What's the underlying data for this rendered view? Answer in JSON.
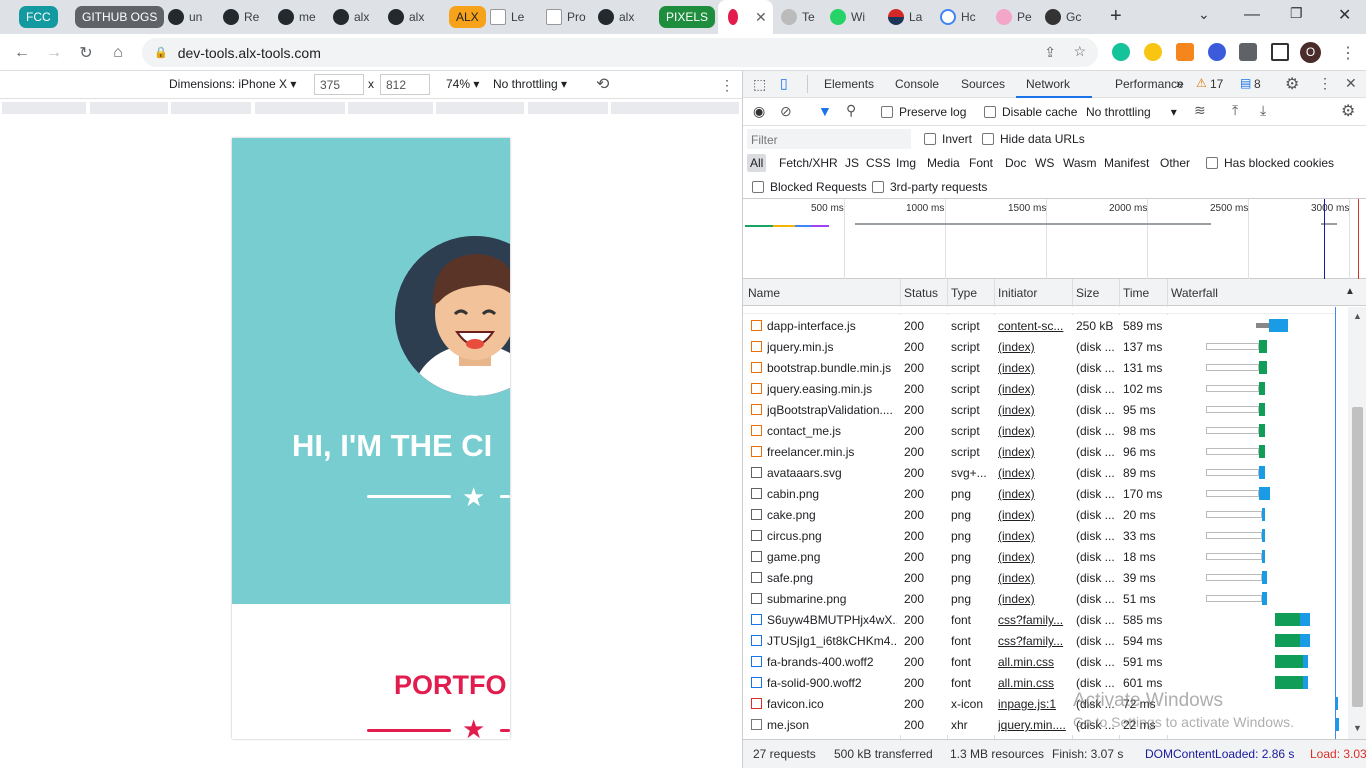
{
  "browser": {
    "tab_groups": [
      {
        "label": "FCC",
        "color": "#129aa0"
      },
      {
        "label": "GITHUB OGS",
        "color": "#5f6368"
      },
      {
        "label": "ALX",
        "color": "#f6a21b"
      },
      {
        "label": "PIXELS",
        "color": "#1e8e3e"
      }
    ],
    "tabs": [
      "un",
      "Re",
      "me",
      "alx",
      "alx",
      "Le",
      "Pro",
      "alx",
      "Te",
      "Wi",
      "La",
      "Hc",
      "Pe",
      "Gc"
    ],
    "url": "dev-tools.alx-tools.com",
    "profile_initial": "O"
  },
  "device_toolbar": {
    "dimensions_label": "Dimensions: iPhone X",
    "width": "375",
    "times": "x",
    "height": "812",
    "zoom": "74%",
    "throttle": "No throttling"
  },
  "page": {
    "hero_title": "HI, I'M THE CI",
    "section_title": "PORTFO",
    "masthead_color": "#78cdd1",
    "accent_color": "#e21d4e"
  },
  "devtools": {
    "tabs": [
      "Elements",
      "Console",
      "Sources",
      "Network",
      "Performance"
    ],
    "active_tab": "Network",
    "warnings": "17",
    "messages": "8",
    "preserve_log": "Preserve log",
    "disable_cache": "Disable cache",
    "throttling": "No throttling",
    "filter_placeholder": "Filter",
    "invert": "Invert",
    "hide_data_urls": "Hide data URLs",
    "type_filters": [
      "All",
      "Fetch/XHR",
      "JS",
      "CSS",
      "Img",
      "Media",
      "Font",
      "Doc",
      "WS",
      "Wasm",
      "Manifest",
      "Other"
    ],
    "has_blocked_cookies": "Has blocked cookies",
    "blocked_requests": "Blocked Requests",
    "third_party": "3rd-party requests",
    "overview_ticks": [
      "500 ms",
      "1000 ms",
      "1500 ms",
      "2000 ms",
      "2500 ms",
      "3000 ms"
    ],
    "columns": [
      "Name",
      "Status",
      "Type",
      "Initiator",
      "Size",
      "Time",
      "Waterfall"
    ],
    "rows": [
      {
        "name": "dapp-interface.js",
        "status": "200",
        "type": "script",
        "initiator": "content-sc...",
        "size": "250 kB",
        "time": "589 ms",
        "wstart": 0.5,
        "wwait": 0.08,
        "wdl": 0.12,
        "icon": "script"
      },
      {
        "name": "jquery.min.js",
        "status": "200",
        "type": "script",
        "initiator": "(index)",
        "size": "(disk ...",
        "time": "137 ms",
        "wstart": 0.2,
        "wwait": 0.32,
        "wdl": 0.05,
        "icon": "script"
      },
      {
        "name": "bootstrap.bundle.min.js",
        "status": "200",
        "type": "script",
        "initiator": "(index)",
        "size": "(disk ...",
        "time": "131 ms",
        "wstart": 0.2,
        "wwait": 0.32,
        "wdl": 0.05,
        "icon": "script"
      },
      {
        "name": "jquery.easing.min.js",
        "status": "200",
        "type": "script",
        "initiator": "(index)",
        "size": "(disk ...",
        "time": "102 ms",
        "wstart": 0.2,
        "wwait": 0.32,
        "wdl": 0.04,
        "icon": "script"
      },
      {
        "name": "jqBootstrapValidation....",
        "status": "200",
        "type": "script",
        "initiator": "(index)",
        "size": "(disk ...",
        "time": "95 ms",
        "wstart": 0.2,
        "wwait": 0.32,
        "wdl": 0.04,
        "icon": "script"
      },
      {
        "name": "contact_me.js",
        "status": "200",
        "type": "script",
        "initiator": "(index)",
        "size": "(disk ...",
        "time": "98 ms",
        "wstart": 0.2,
        "wwait": 0.32,
        "wdl": 0.04,
        "icon": "script"
      },
      {
        "name": "freelancer.min.js",
        "status": "200",
        "type": "script",
        "initiator": "(index)",
        "size": "(disk ...",
        "time": "96 ms",
        "wstart": 0.2,
        "wwait": 0.32,
        "wdl": 0.04,
        "icon": "script"
      },
      {
        "name": "avataaars.svg",
        "status": "200",
        "type": "svg+...",
        "initiator": "(index)",
        "size": "(disk ...",
        "time": "89 ms",
        "wstart": 0.2,
        "wwait": 0.32,
        "wdl": 0.04,
        "icon": "img"
      },
      {
        "name": "cabin.png",
        "status": "200",
        "type": "png",
        "initiator": "(index)",
        "size": "(disk ...",
        "time": "170 ms",
        "wstart": 0.2,
        "wwait": 0.32,
        "wdl": 0.07,
        "icon": "img"
      },
      {
        "name": "cake.png",
        "status": "200",
        "type": "png",
        "initiator": "(index)",
        "size": "(disk ...",
        "time": "20 ms",
        "wstart": 0.2,
        "wwait": 0.34,
        "wdl": 0.02,
        "icon": "img"
      },
      {
        "name": "circus.png",
        "status": "200",
        "type": "png",
        "initiator": "(index)",
        "size": "(disk ...",
        "time": "33 ms",
        "wstart": 0.2,
        "wwait": 0.34,
        "wdl": 0.02,
        "icon": "img"
      },
      {
        "name": "game.png",
        "status": "200",
        "type": "png",
        "initiator": "(index)",
        "size": "(disk ...",
        "time": "18 ms",
        "wstart": 0.2,
        "wwait": 0.34,
        "wdl": 0.02,
        "icon": "img"
      },
      {
        "name": "safe.png",
        "status": "200",
        "type": "png",
        "initiator": "(index)",
        "size": "(disk ...",
        "time": "39 ms",
        "wstart": 0.2,
        "wwait": 0.34,
        "wdl": 0.03,
        "icon": "img"
      },
      {
        "name": "submarine.png",
        "status": "200",
        "type": "png",
        "initiator": "(index)",
        "size": "(disk ...",
        "time": "51 ms",
        "wstart": 0.2,
        "wwait": 0.34,
        "wdl": 0.03,
        "icon": "img"
      },
      {
        "name": "S6uyw4BMUTPHjx4wX...",
        "status": "200",
        "type": "font",
        "initiator": "css?family...",
        "size": "(disk ...",
        "time": "585 ms",
        "wstart": 0.62,
        "wwait": 0.15,
        "wdl": 0.06,
        "icon": "font"
      },
      {
        "name": "JTUSjIg1_i6t8kCHKm4...",
        "status": "200",
        "type": "font",
        "initiator": "css?family...",
        "size": "(disk ...",
        "time": "594 ms",
        "wstart": 0.62,
        "wwait": 0.15,
        "wdl": 0.06,
        "icon": "font"
      },
      {
        "name": "fa-brands-400.woff2",
        "status": "200",
        "type": "font",
        "initiator": "all.min.css",
        "size": "(disk ...",
        "time": "591 ms",
        "wstart": 0.62,
        "wwait": 0.17,
        "wdl": 0.03,
        "icon": "font"
      },
      {
        "name": "fa-solid-900.woff2",
        "status": "200",
        "type": "font",
        "initiator": "all.min.css",
        "size": "(disk ...",
        "time": "601 ms",
        "wstart": 0.62,
        "wwait": 0.17,
        "wdl": 0.03,
        "icon": "font"
      },
      {
        "name": "favicon.ico",
        "status": "200",
        "type": "x-icon",
        "initiator": "inpage.js:1",
        "size": "(disk ...",
        "time": "72 ms",
        "wstart": 0.98,
        "wwait": 0.0,
        "wdl": 0.02,
        "icon": "ico"
      },
      {
        "name": "me.json",
        "status": "200",
        "type": "xhr",
        "initiator": "jquery.min....",
        "size": "(disk ...",
        "time": "22 ms",
        "wstart": 0.99,
        "wwait": 0.0,
        "wdl": 0.01,
        "icon": "xhr"
      }
    ],
    "status_bar": {
      "requests": "27 requests",
      "transferred": "500 kB transferred",
      "resources": "1.3 MB resources",
      "finish": "Finish: 3.07 s",
      "dcl": "DOMContentLoaded: 2.86 s",
      "load": "Load: 3.03"
    }
  },
  "os_watermark": {
    "title": "Activate Windows",
    "subtitle": "Go to Settings to activate Windows."
  }
}
